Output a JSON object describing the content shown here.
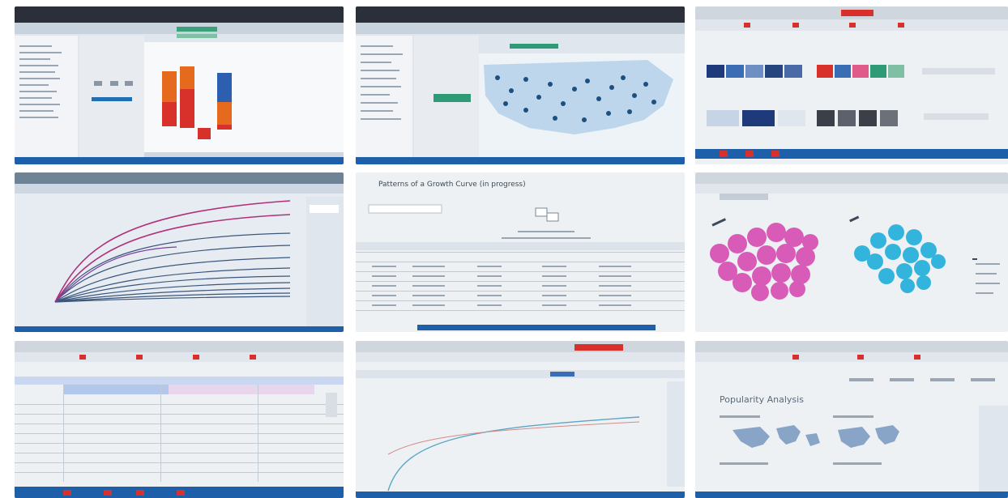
{
  "collage": {
    "tiles": [
      {
        "id": "bar-chart-desktop"
      },
      {
        "id": "us-map-desktop"
      },
      {
        "id": "browser-gallery"
      },
      {
        "id": "line-curves"
      },
      {
        "id": "data-table"
      },
      {
        "id": "bubble-clusters"
      },
      {
        "id": "spreadsheet"
      },
      {
        "id": "growth-curve"
      },
      {
        "id": "world-map-dashboard"
      }
    ],
    "colors": {
      "taskbar": "#1d5fa8",
      "bar_red": "#d8302a",
      "bar_orange": "#e66a1e",
      "bar_blue": "#2d5fb0",
      "map_green": "#2e9a76",
      "bubble_pink": "#d95bb8",
      "bubble_cyan": "#33b4dc",
      "curve_navy": "#1d3d66",
      "curve_pink": "#b1307a",
      "curve_teal": "#5aa6c4"
    },
    "texts": {
      "center_tile_title": "Patterns of a Growth Curve (in progress)",
      "bottom_right_title": "Popularity Analysis"
    }
  }
}
